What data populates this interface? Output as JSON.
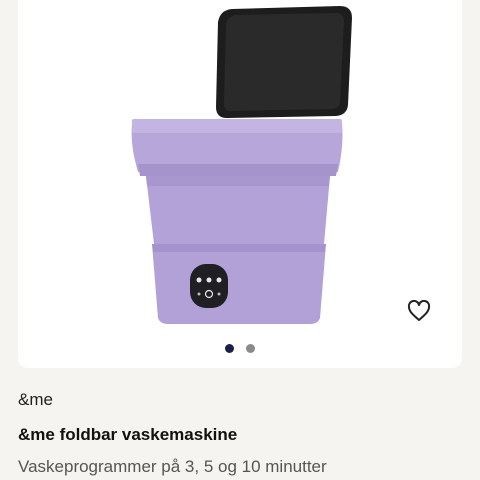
{
  "product": {
    "brand": "&me",
    "name": "&me foldbar vaskemaskine",
    "description": "Vaskeprogrammer på 3, 5 og 10 minutter"
  },
  "gallery": {
    "image_count": 2,
    "active_index": 0,
    "dot_active_color": "#1c1f4a",
    "dot_inactive_color": "#8a8a8a"
  },
  "icons": {
    "favorite": "heart-outline-icon"
  },
  "colors": {
    "page_bg": "#f5f4f1",
    "card_bg": "#ffffff",
    "machine_purple": "#b4a3d9",
    "lid_black": "#1d1d1d"
  }
}
